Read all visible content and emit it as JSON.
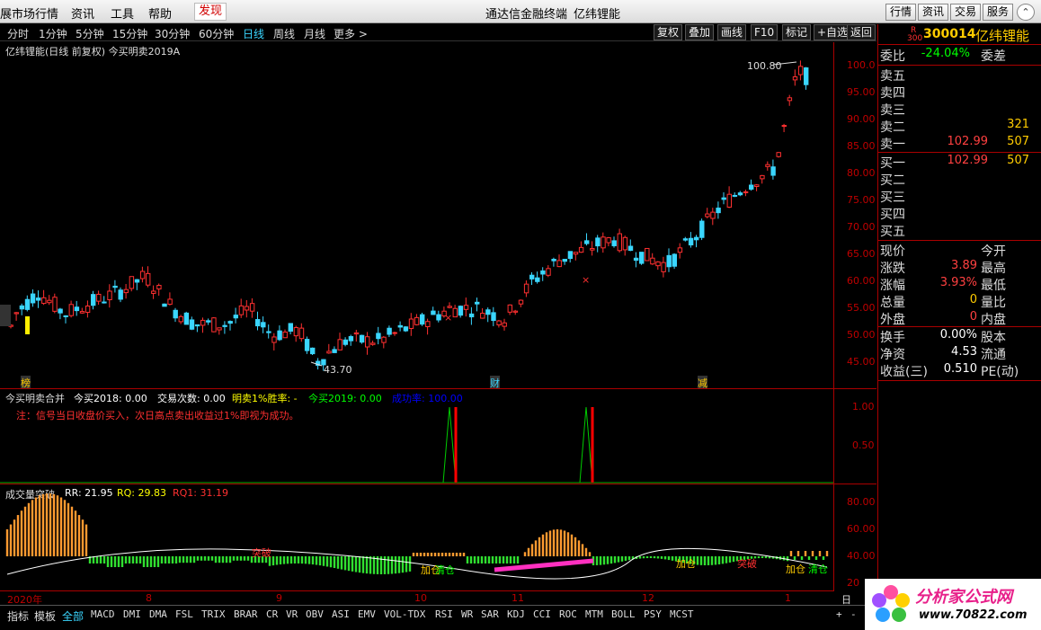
{
  "menu": {
    "items": [
      "展市场行情",
      "资讯",
      "工具",
      "帮助",
      "发现"
    ],
    "center_title": "通达信金融终端",
    "stock_title": "亿纬锂能",
    "right_buttons": [
      "行情",
      "资讯",
      "交易",
      "服务"
    ]
  },
  "periods": {
    "items": [
      "分时",
      "1分钟",
      "5分钟",
      "15分钟",
      "30分钟",
      "60分钟",
      "日线",
      "周线",
      "月线",
      "更多 >"
    ],
    "selected": "日线",
    "tools": [
      "复权",
      "叠加",
      "画线",
      "F10",
      "标记",
      "+自选",
      "返回"
    ]
  },
  "main_chart": {
    "title": "亿纬锂能(日线 前复权) 今买明卖2019A",
    "high_label": "100.80",
    "low_label": "43.70",
    "events": [
      "榜",
      "财",
      "减"
    ],
    "sell_marks": [
      "×",
      "×"
    ],
    "y_ticks": [
      "100.0",
      "95.00",
      "90.00",
      "85.00",
      "80.00",
      "75.00",
      "70.00",
      "65.00",
      "60.00",
      "55.00",
      "50.00",
      "45.00"
    ]
  },
  "indicator1": {
    "name": "今买明卖合并",
    "values": [
      {
        "label": "今买2018: 0.00",
        "color": "#ffffff"
      },
      {
        "label": "交易次数: 0.00",
        "color": "#ffffff"
      },
      {
        "label": "明卖1%胜率: -",
        "color": "#ffff00"
      },
      {
        "label": "今买2019: 0.00",
        "color": "#00ff00"
      },
      {
        "label": "成功率: 100.00",
        "color": "#0000ff"
      }
    ],
    "note": "注：信号当日收盘价买入，次日高点卖出收益过1%即视为成功。",
    "y_ticks": [
      "1.00",
      "0.50"
    ]
  },
  "indicator2": {
    "name": "成交量突破",
    "values": [
      {
        "label": "RR: 21.95",
        "color": "#ffffff"
      },
      {
        "label": "RQ: 29.83",
        "color": "#ffff00"
      },
      {
        "label": "RQ1: 31.19",
        "color": "#ff3030"
      }
    ],
    "y_ticks": [
      "80.00",
      "60.00",
      "40.00",
      "20"
    ],
    "annotations": [
      "加仓",
      "清仓",
      "突破"
    ]
  },
  "date_axis": [
    "2020年",
    "8",
    "9",
    "10",
    "11",
    "12",
    "1"
  ],
  "date_axis_right": "日线",
  "indicator_tabs": {
    "left": [
      "指标",
      "模板",
      "全部"
    ],
    "items": [
      "MACD",
      "DMI",
      "DMA",
      "FSL",
      "TRIX",
      "BRAR",
      "CR",
      "VR",
      "OBV",
      "ASI",
      "EMV",
      "VOL-TDX",
      "RSI",
      "WR",
      "SAR",
      "KDJ",
      "CCI",
      "ROC",
      "MTM",
      "BOLL",
      "PSY",
      "MCST"
    ],
    "selected": "全部"
  },
  "quote": {
    "code": "300014",
    "name": "亿纬锂能",
    "board_mark": "R",
    "board_index": "300",
    "weibi_label": "委比",
    "weibi_value": "-24.04%",
    "weicha_label": "委差",
    "sells": [
      {
        "label": "卖五",
        "price": "",
        "vol": ""
      },
      {
        "label": "卖四",
        "price": "",
        "vol": ""
      },
      {
        "label": "卖三",
        "price": "",
        "vol": ""
      },
      {
        "label": "卖二",
        "price": "",
        "vol": "321"
      },
      {
        "label": "卖一",
        "price": "102.99",
        "vol": "507"
      }
    ],
    "buys": [
      {
        "label": "买一",
        "price": "102.99",
        "vol": "507"
      },
      {
        "label": "买二",
        "price": "",
        "vol": ""
      },
      {
        "label": "买三",
        "price": "",
        "vol": ""
      },
      {
        "label": "买四",
        "price": "",
        "vol": ""
      },
      {
        "label": "买五",
        "price": "",
        "vol": ""
      }
    ],
    "stats": [
      {
        "k": "现价",
        "v": "",
        "k2": "今开",
        "c": "#ffffff"
      },
      {
        "k": "涨跌",
        "v": "3.89",
        "k2": "最高",
        "c": "#ff4040"
      },
      {
        "k": "涨幅",
        "v": "3.93%",
        "k2": "最低",
        "c": "#ff4040"
      },
      {
        "k": "总量",
        "v": "0",
        "k2": "量比",
        "c": "#ffcc00"
      },
      {
        "k": "外盘",
        "v": "0",
        "k2": "内盘",
        "c": "#ff4040"
      }
    ],
    "stats2": [
      {
        "k": "换手",
        "v": "0.00%",
        "k2": "股本"
      },
      {
        "k": "净资",
        "v": "4.53",
        "k2": "流通"
      },
      {
        "k": "收益(三)",
        "v": "0.510",
        "k2": "PE(动)"
      }
    ]
  },
  "watermark": {
    "text": "分析家公式网",
    "url": "www.70822.com"
  }
}
